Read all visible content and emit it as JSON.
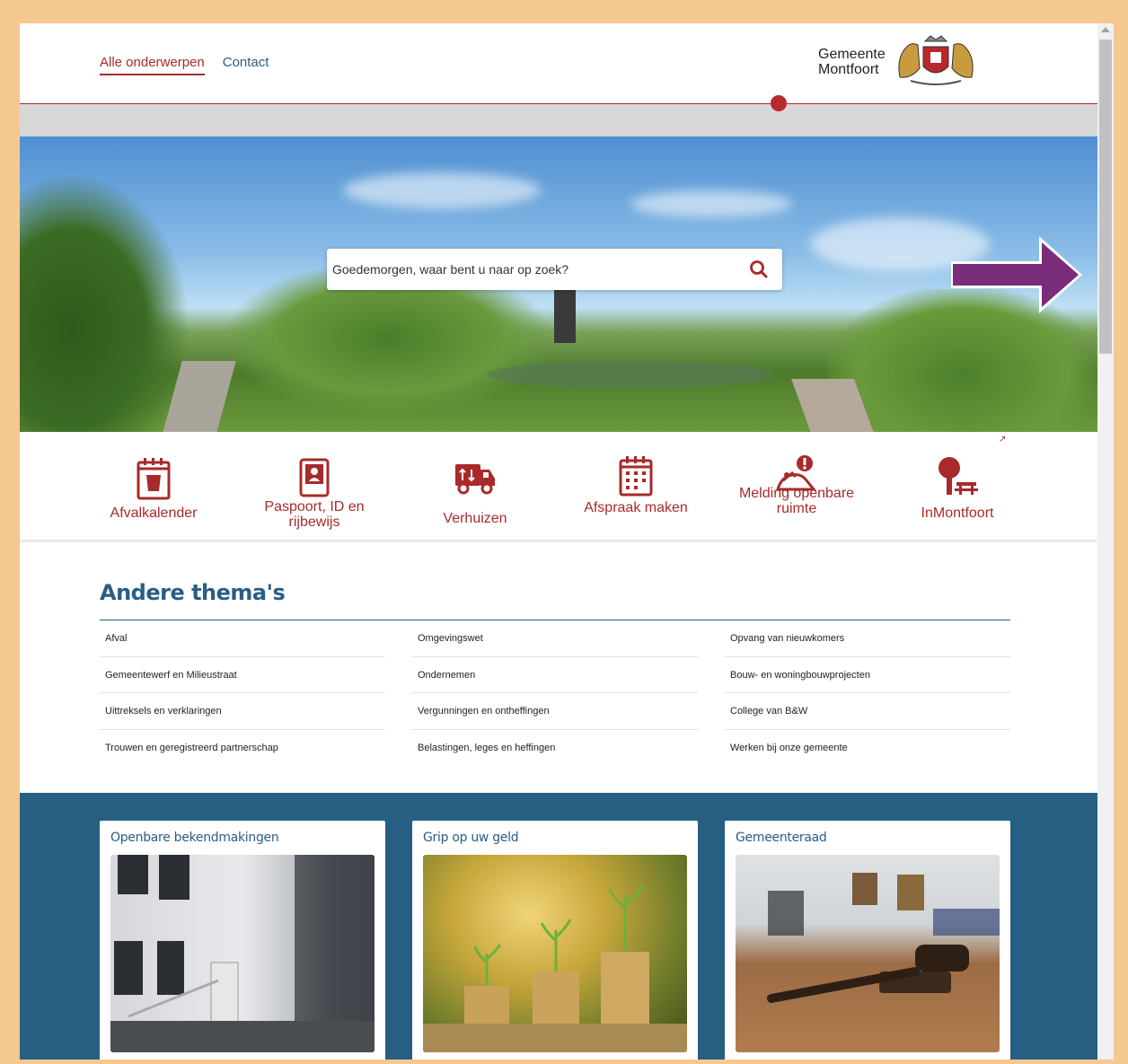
{
  "nav": {
    "items": [
      {
        "label": "Alle onderwerpen",
        "active": true
      },
      {
        "label": "Contact",
        "active": false
      }
    ]
  },
  "logo": {
    "line1": "Gemeente",
    "line2": "Montfoort"
  },
  "search": {
    "placeholder": "Goedemorgen, waar bent u naar op zoek?"
  },
  "quick_links": [
    {
      "label": "Afvalkalender",
      "icon": "waste-bin-icon"
    },
    {
      "label": "Paspoort, ID en rijbewijs",
      "icon": "passport-icon"
    },
    {
      "label": "Verhuizen",
      "icon": "moving-truck-icon"
    },
    {
      "label": "Afspraak maken",
      "icon": "calendar-icon"
    },
    {
      "label": "Melding openbare ruimte",
      "icon": "report-issue-icon"
    },
    {
      "label": "InMontfoort",
      "icon": "tree-bench-icon"
    }
  ],
  "themes": {
    "title": "Andere thema's",
    "columns": [
      [
        "Afval",
        "Gemeentewerf en Milieustraat",
        "Uittreksels en verklaringen",
        "Trouwen en geregistreerd partnerschap"
      ],
      [
        "Omgevingswet",
        "Ondernemen",
        "Vergunningen en ontheffingen",
        "Belastingen, leges en heffingen"
      ],
      [
        "Opvang van nieuwkomers",
        "Bouw- en woningbouwprojecten",
        "College van B&W",
        "Werken bij onze gemeente"
      ]
    ]
  },
  "cards": [
    {
      "title": "Openbare bekendmakingen"
    },
    {
      "title": "Grip op uw geld"
    },
    {
      "title": "Gemeenteraad"
    }
  ],
  "colors": {
    "accent": "#a82a2a",
    "brand_blue": "#2a5d84",
    "section_blue": "#275f83",
    "annotation_arrow": "#7a2d7a"
  }
}
